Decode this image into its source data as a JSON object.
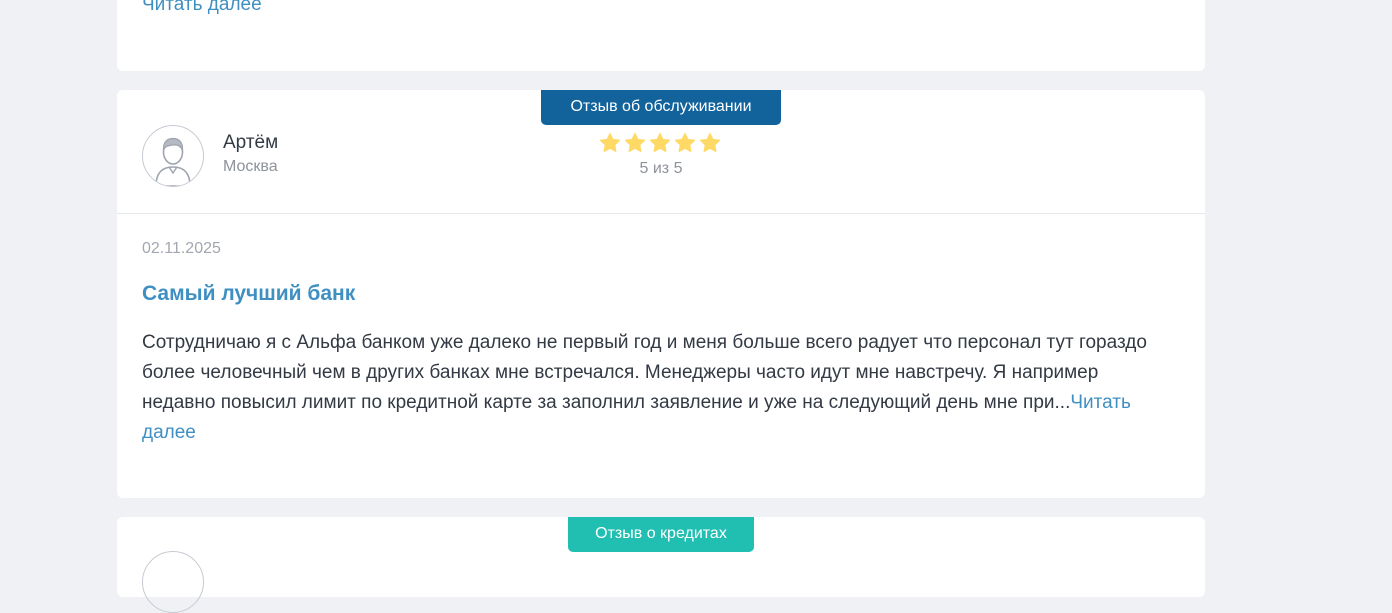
{
  "previous_review": {
    "read_more": "Читать далее"
  },
  "review": {
    "category_tag": "Отзыв об обслуживании",
    "author": {
      "name": "Артём",
      "city": "Москва",
      "avatar_icon": "user-avatar-icon"
    },
    "rating": {
      "value": 5,
      "max": 5,
      "label": "5 из 5",
      "star_color": "#ffd966",
      "star_icon": "star-icon"
    },
    "date": "02.11.2025",
    "title": "Самый лучший банк",
    "text": "Сотрудничаю я с Альфа банком уже далеко не первый год и меня больше всего радует что персонал тут гораздо более человечный чем в других банках мне встречался. Менеджеры часто идут мне навстречу. Я например недавно повысил лимит по кредитной карте за заполнил заявление и уже на следующий день мне при...",
    "read_more": "Читать далее"
  },
  "next_review": {
    "category_tag": "Отзыв о кредитах"
  },
  "colors": {
    "page_bg": "#eff1f4",
    "card_bg": "#ffffff",
    "accent_link": "#3f8fc2",
    "tag_service": "#12639c",
    "tag_credit": "#20bfb1",
    "muted_text": "#8d929b"
  }
}
